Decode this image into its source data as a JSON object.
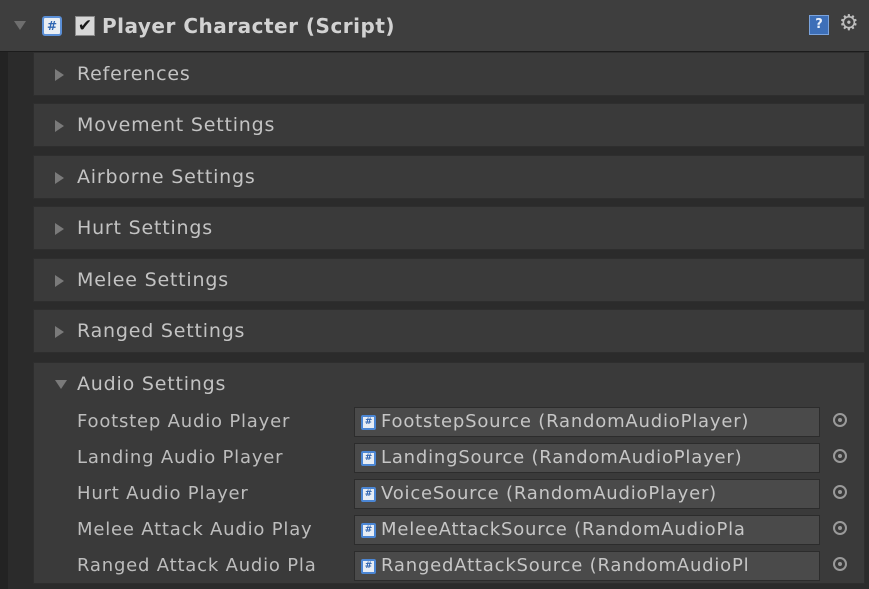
{
  "component": {
    "title": "Player Character (Script)",
    "enabled_mark": "✔",
    "script_icon_glyph": "#",
    "help_icon_glyph": "?",
    "gear_icon_glyph": "⚙"
  },
  "sections": [
    {
      "label": "References",
      "expanded": false
    },
    {
      "label": "Movement Settings",
      "expanded": false
    },
    {
      "label": "Airborne Settings",
      "expanded": false
    },
    {
      "label": "Hurt Settings",
      "expanded": false
    },
    {
      "label": "Melee Settings",
      "expanded": false
    },
    {
      "label": "Ranged Settings",
      "expanded": false
    }
  ],
  "audio": {
    "label": "Audio Settings",
    "expanded": true,
    "fields": [
      {
        "label": "Footstep Audio Player",
        "value": "FootstepSource (RandomAudioPlayer)"
      },
      {
        "label": "Landing Audio Player",
        "value": "LandingSource (RandomAudioPlayer)"
      },
      {
        "label": "Hurt Audio Player",
        "value": "VoiceSource (RandomAudioPlayer)"
      },
      {
        "label": "Melee Attack Audio Play",
        "value": "MeleeAttackSource (RandomAudioPla"
      },
      {
        "label": "Ranged Attack Audio Pla",
        "value": "RangedAttackSource (RandomAudioPl"
      }
    ]
  },
  "colors": {
    "header_bg": "#3e3e3e",
    "section_bg": "#3a3a3a",
    "field_bg": "#4a4a4a",
    "accent_blue": "#3d6fb8"
  }
}
